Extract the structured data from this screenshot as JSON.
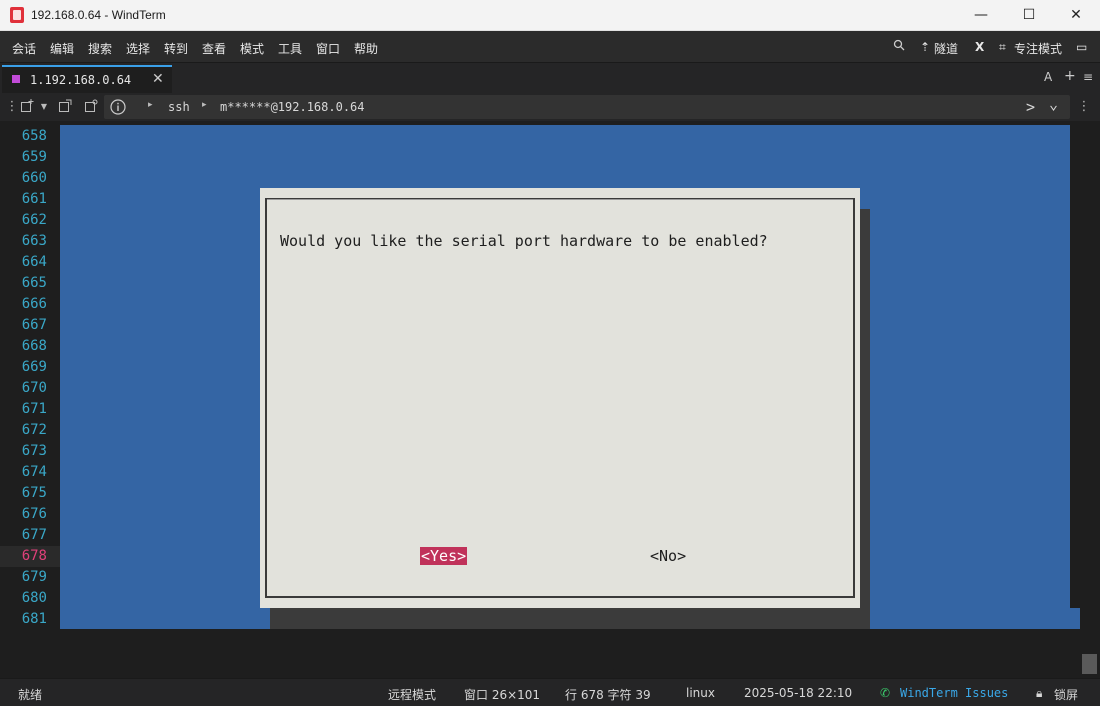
{
  "window": {
    "title": "192.168.0.64 - WindTerm",
    "controls": {
      "minimize": "—",
      "maximize": "☐",
      "close": "✕"
    }
  },
  "menu": {
    "items": [
      "会话",
      "编辑",
      "搜索",
      "选择",
      "转到",
      "查看",
      "模式",
      "工具",
      "窗口",
      "帮助"
    ],
    "tunnel": "隧道",
    "x": "X",
    "focus_mode": "专注模式"
  },
  "tabs": [
    {
      "label": "1.192.168.0.64",
      "close": "✕"
    }
  ],
  "tabbar_right": {
    "font": "A",
    "add": "+",
    "menu": "≡"
  },
  "address": {
    "crumbs": [
      "ssh",
      "m******@192.168.0.64"
    ],
    "next": ">",
    "dropdown": "⌄",
    "more": "⋮"
  },
  "terminal": {
    "line_numbers": [
      "658",
      "659",
      "660",
      "661",
      "662",
      "663",
      "664",
      "665",
      "666",
      "667",
      "668",
      "669",
      "670",
      "671",
      "672",
      "673",
      "674",
      "675",
      "676",
      "677",
      "678",
      "679",
      "680",
      "681"
    ],
    "active_line": "678",
    "colors": {
      "background": "#3465a4",
      "dialog": "#e2e2dc",
      "highlight": "#c0325a"
    }
  },
  "dialog": {
    "message": "Would you like the serial port hardware to be enabled?",
    "yes": "<Yes>",
    "no": "<No>"
  },
  "status": {
    "ready": "就绪",
    "remote_mode": "远程模式",
    "window_size": "窗口 26×101",
    "position": "行 678 字符 39",
    "os": "linux",
    "datetime": "2025-05-18 22:10",
    "issues_link": "WindTerm Issues",
    "lock": "锁屏"
  }
}
